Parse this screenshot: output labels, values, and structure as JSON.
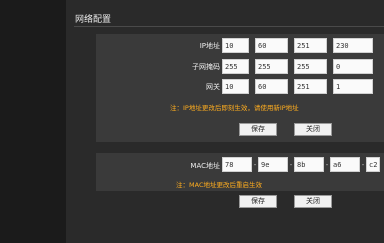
{
  "section_title": "网络配置",
  "network": {
    "ip": {
      "label": "IP地址",
      "octets": [
        "10",
        "60",
        "251",
        "230"
      ]
    },
    "mask": {
      "label": "子网掩码",
      "octets": [
        "255",
        "255",
        "255",
        "0"
      ]
    },
    "gateway": {
      "label": "网关",
      "octets": [
        "10",
        "60",
        "251",
        "1"
      ]
    },
    "note": "注：IP地址更改后即刻生效，请使用新IP地址",
    "save_label": "保存",
    "close_label": "关闭"
  },
  "mac": {
    "label": "MAC地址",
    "parts": [
      "78",
      "9e",
      "8b",
      "a6",
      "c2"
    ],
    "separator": "-",
    "note": "注：MAC地址更改后重启生效",
    "save_label": "保存",
    "close_label": "关闭"
  }
}
